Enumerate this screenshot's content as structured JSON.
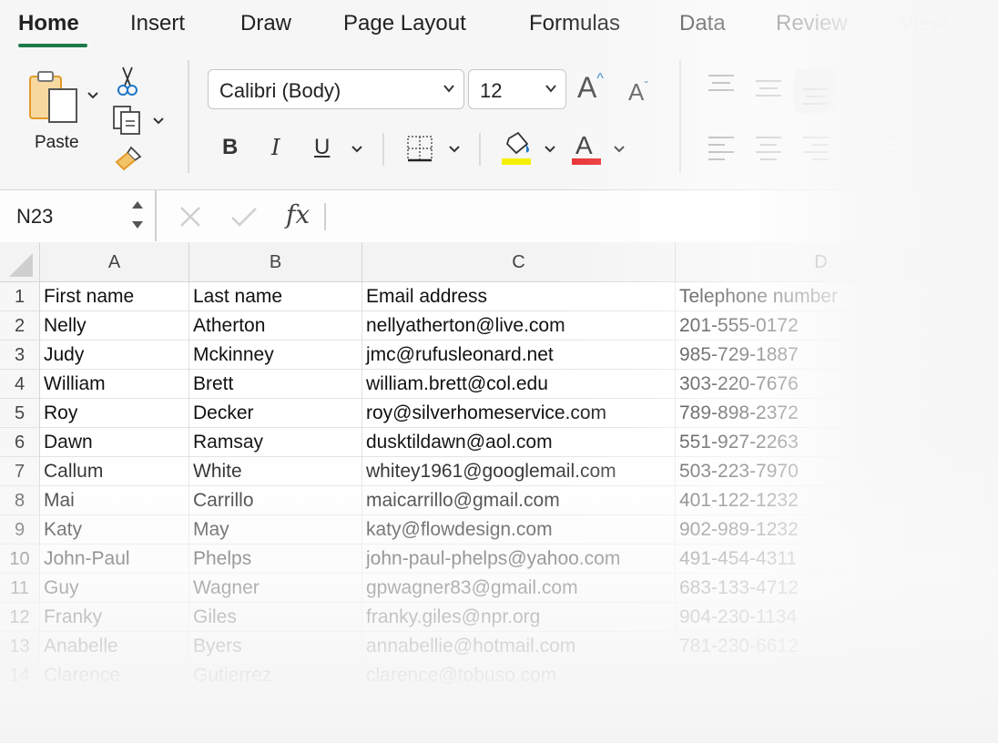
{
  "tabs": [
    {
      "label": "Home",
      "active": true
    },
    {
      "label": "Insert"
    },
    {
      "label": "Draw"
    },
    {
      "label": "Page Layout"
    },
    {
      "label": "Formulas"
    },
    {
      "label": "Data"
    },
    {
      "label": "Review"
    },
    {
      "label": "View"
    }
  ],
  "ribbon": {
    "paste_label": "Paste",
    "font_name": "Calibri (Body)",
    "font_size": "12",
    "bold": "B",
    "italic": "I",
    "underline": "U",
    "increase_font": "A",
    "decrease_font": "A",
    "font_color_glyph": "A",
    "highlight_color": "#f4f000",
    "font_color": "#e8262a",
    "accent_color": "#1d7a4a"
  },
  "formula_bar": {
    "name_box": "N23",
    "fx_label": "fx",
    "formula": ""
  },
  "sheet": {
    "columns": [
      "A",
      "B",
      "C",
      "D"
    ],
    "row_numbers": [
      "1",
      "2",
      "3",
      "4",
      "5",
      "6",
      "7",
      "8",
      "9",
      "10",
      "11",
      "12",
      "13",
      "14"
    ],
    "rows": [
      [
        "First name",
        "Last name",
        "Email address",
        "Telephone number"
      ],
      [
        "Nelly",
        "Atherton",
        "nellyatherton@live.com",
        "201-555-0172"
      ],
      [
        "Judy",
        "Mckinney",
        "jmc@rufusleonard.net",
        "985-729-1887"
      ],
      [
        "William",
        "Brett",
        "william.brett@col.edu",
        "303-220-7676"
      ],
      [
        "Roy",
        "Decker",
        "roy@silverhomeservice.com",
        "789-898-2372"
      ],
      [
        "Dawn",
        "Ramsay",
        "dusktildawn@aol.com",
        "551-927-2263"
      ],
      [
        "Callum",
        "White",
        "whitey1961@googlemail.com",
        "503-223-7970"
      ],
      [
        "Mai",
        "Carrillo",
        "maicarrillo@gmail.com",
        "401-122-1232"
      ],
      [
        "Katy",
        "May",
        "katy@flowdesign.com",
        "902-989-1232"
      ],
      [
        "John-Paul",
        "Phelps",
        "john-paul-phelps@yahoo.com",
        "491-454-4311"
      ],
      [
        "Guy",
        "Wagner",
        "gpwagner83@gmail.com",
        "683-133-4712"
      ],
      [
        "Franky",
        "Giles",
        "franky.giles@npr.org",
        "904-230-1134"
      ],
      [
        "Anabelle",
        "Byers",
        "annabellie@hotmail.com",
        "781-230-6612"
      ],
      [
        "Clarence",
        "Gutierrez",
        "clarence@tobuso.com",
        ""
      ]
    ]
  }
}
